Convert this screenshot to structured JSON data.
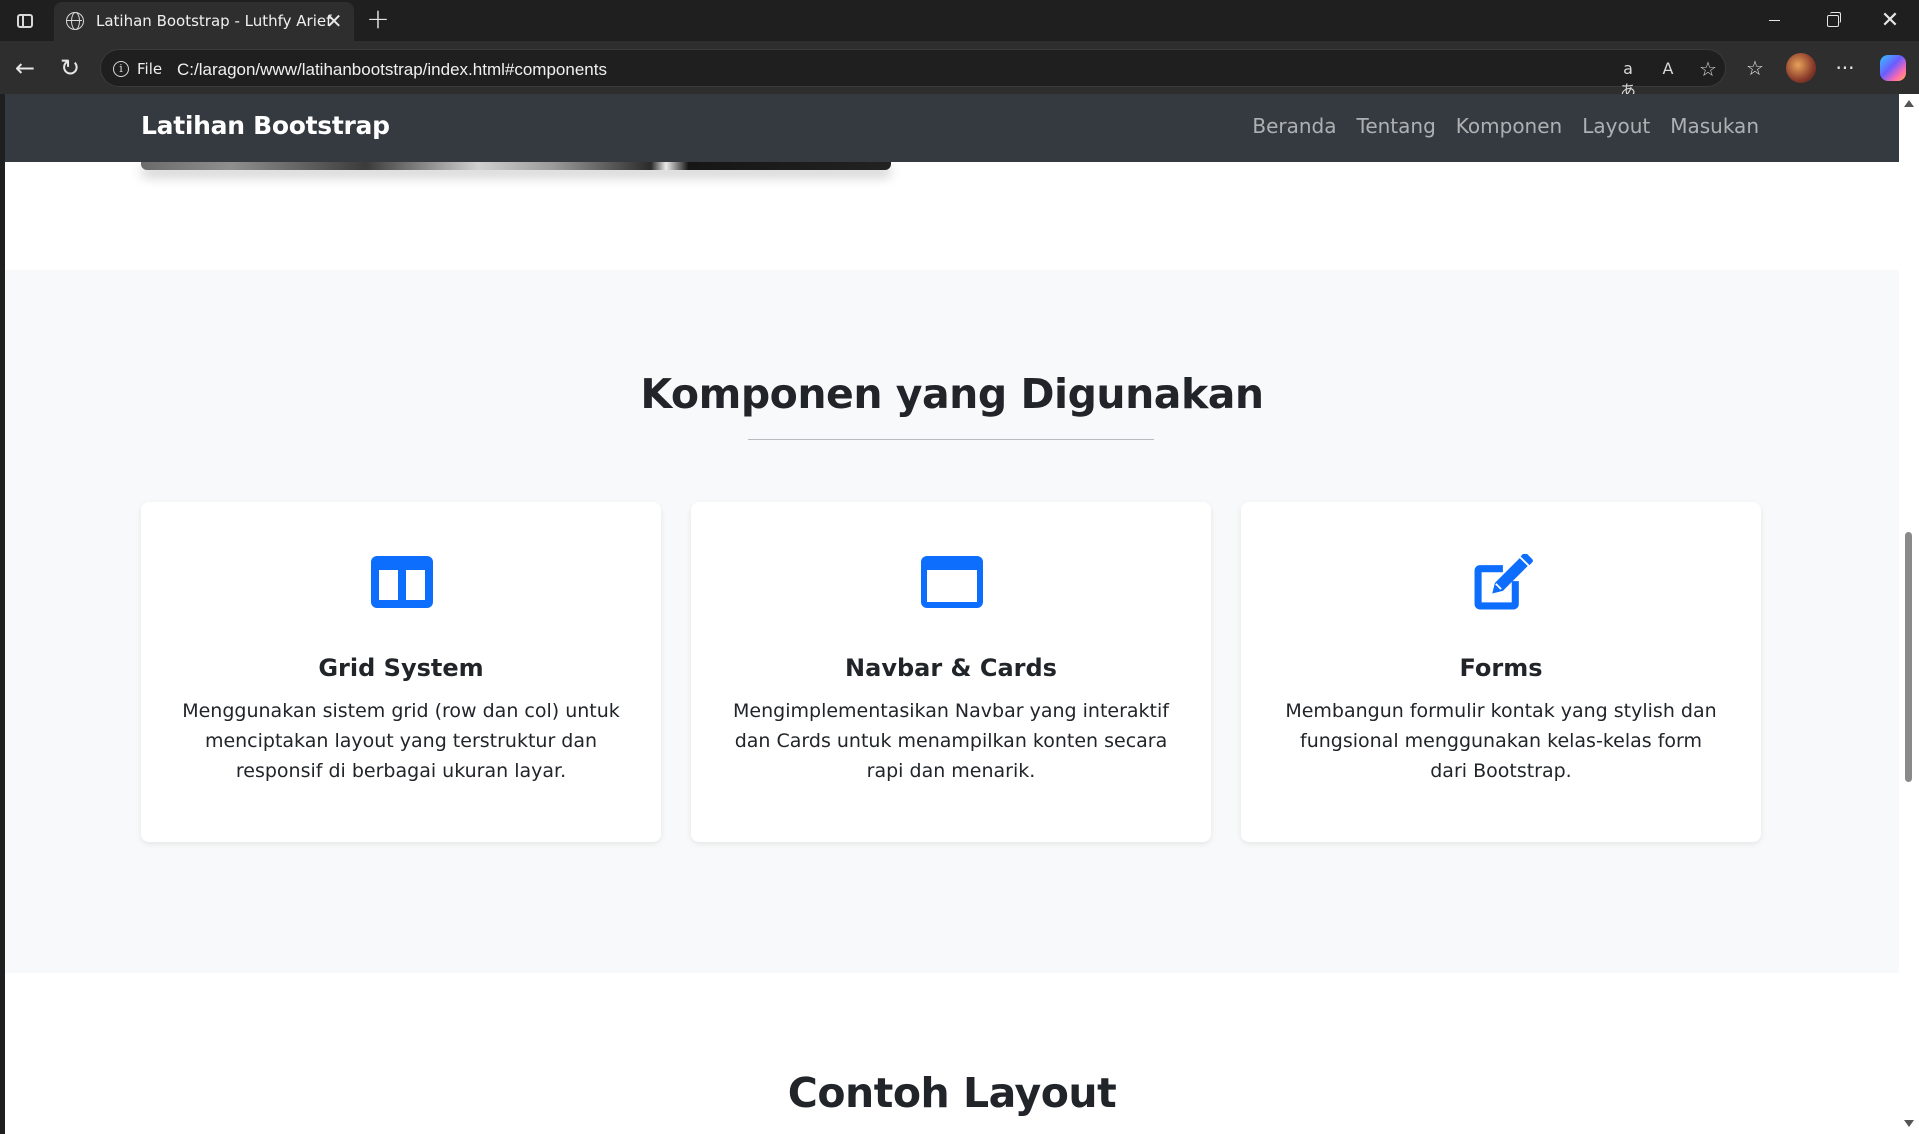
{
  "browser": {
    "tab_title": "Latihan Bootstrap - Luthfy Arief",
    "tab_close": "✕",
    "new_tab": "+",
    "win_close": "✕",
    "file_label": "File",
    "url": "C:/laragon/www/latihanbootstrap/index.html#components",
    "back": "←",
    "reload": "↻",
    "info": "i",
    "translate": "aあ",
    "read_aloud": "A",
    "favorite": "☆",
    "favorites_bar": "☆",
    "more": "···"
  },
  "site": {
    "brand": "Latihan Bootstrap",
    "nav": [
      "Beranda",
      "Tentang",
      "Komponen",
      "Layout",
      "Masukan"
    ]
  },
  "components": {
    "title": "Komponen yang Digunakan",
    "cards": [
      {
        "icon": "layout-columns-icon",
        "title": "Grid System",
        "text": "Menggunakan sistem grid (row dan col) untuk menciptakan layout yang terstruktur dan responsif di berbagai ukuran layar."
      },
      {
        "icon": "browser-window-icon",
        "title": "Navbar & Cards",
        "text": "Mengimplementasikan Navbar yang interaktif dan Cards untuk menampilkan konten secara rapi dan menarik."
      },
      {
        "icon": "pencil-square-icon",
        "title": "Forms",
        "text": "Membangun formulir kontak yang stylish dan fungsional menggunakan kelas-kelas form dari Bootstrap."
      }
    ]
  },
  "layout_section": {
    "title": "Contoh Layout"
  },
  "colors": {
    "navbar_bg": "#343a40",
    "icon_blue": "#0d6efd",
    "section_bg": "#f8f9fa"
  }
}
